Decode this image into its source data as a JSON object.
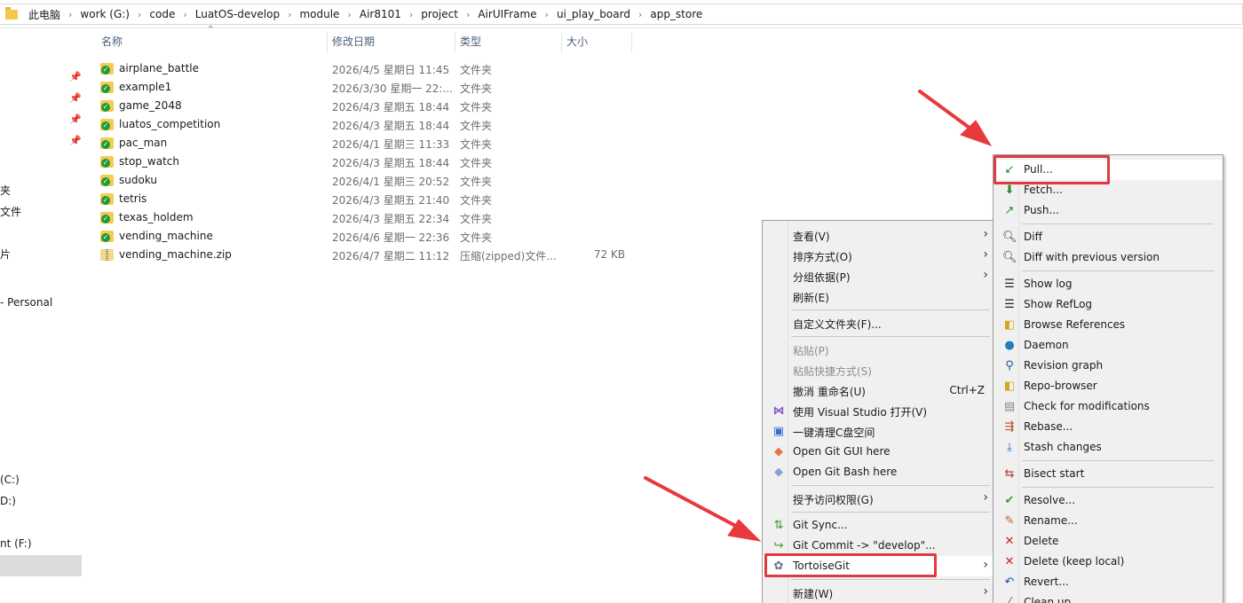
{
  "breadcrumb": [
    "此电脑",
    "work (G:)",
    "code",
    "LuatOS-develop",
    "module",
    "Air8101",
    "project",
    "AirUIFrame",
    "ui_play_board",
    "app_store"
  ],
  "nav": {
    "items": [
      "夹",
      "文件",
      "片",
      "- Personal",
      "(C:)",
      "D:)",
      "nt (F:)"
    ]
  },
  "columns": {
    "name": "名称",
    "date": "修改日期",
    "type": "类型",
    "size": "大小"
  },
  "files": [
    {
      "name": "airplane_battle",
      "date": "2026/4/5 星期日 11:45",
      "type": "文件夹",
      "size": "",
      "zip": false
    },
    {
      "name": "example1",
      "date": "2026/3/30 星期一 22:...",
      "type": "文件夹",
      "size": "",
      "zip": false
    },
    {
      "name": "game_2048",
      "date": "2026/4/3 星期五 18:44",
      "type": "文件夹",
      "size": "",
      "zip": false
    },
    {
      "name": "luatos_competition",
      "date": "2026/4/3 星期五 18:44",
      "type": "文件夹",
      "size": "",
      "zip": false
    },
    {
      "name": "pac_man",
      "date": "2026/4/1 星期三 11:33",
      "type": "文件夹",
      "size": "",
      "zip": false
    },
    {
      "name": "stop_watch",
      "date": "2026/4/3 星期五 18:44",
      "type": "文件夹",
      "size": "",
      "zip": false
    },
    {
      "name": "sudoku",
      "date": "2026/4/1 星期三 20:52",
      "type": "文件夹",
      "size": "",
      "zip": false
    },
    {
      "name": "tetris",
      "date": "2026/4/3 星期五 21:40",
      "type": "文件夹",
      "size": "",
      "zip": false
    },
    {
      "name": "texas_holdem",
      "date": "2026/4/3 星期五 22:34",
      "type": "文件夹",
      "size": "",
      "zip": false
    },
    {
      "name": "vending_machine",
      "date": "2026/4/6 星期一 22:36",
      "type": "文件夹",
      "size": "",
      "zip": false
    },
    {
      "name": "vending_machine.zip",
      "date": "2026/4/7 星期二 11:12",
      "type": "压缩(zipped)文件...",
      "size": "72 KB",
      "zip": true
    }
  ],
  "context_menu": {
    "view": "查看(V)",
    "sort": "排序方式(O)",
    "group": "分组依据(P)",
    "refresh": "刷新(E)",
    "customize": "自定义文件夹(F)...",
    "paste": "粘贴(P)",
    "paste_shortcut": "粘贴快捷方式(S)",
    "undo": "撤消 重命名(U)",
    "undo_shortcut": "Ctrl+Z",
    "vs": "使用 Visual Studio 打开(V)",
    "clean": "一键清理C盘空间",
    "git_gui": "Open Git GUI here",
    "git_bash": "Open Git Bash here",
    "access": "授予访问权限(G)",
    "git_sync": "Git Sync...",
    "git_commit": "Git Commit -> \"develop\"...",
    "tortoise": "TortoiseGit",
    "new": "新建(W)"
  },
  "tortoise_menu": {
    "pull": "Pull...",
    "fetch": "Fetch...",
    "push": "Push...",
    "diff": "Diff",
    "diff_prev": "Diff with previous version",
    "show_log": "Show log",
    "show_reflog": "Show RefLog",
    "browse_refs": "Browse References",
    "daemon": "Daemon",
    "rev_graph": "Revision graph",
    "repo_browser": "Repo-browser",
    "check_mods": "Check for modifications",
    "rebase": "Rebase...",
    "stash": "Stash changes",
    "bisect": "Bisect start",
    "resolve": "Resolve...",
    "rename": "Rename...",
    "delete": "Delete",
    "delete_keep": "Delete (keep local)",
    "revert": "Revert...",
    "cleanup": "Clean up..."
  },
  "colors": {
    "annotation": "#e0393e",
    "check": "#1d9a3a",
    "folder": "#f7cb52"
  }
}
